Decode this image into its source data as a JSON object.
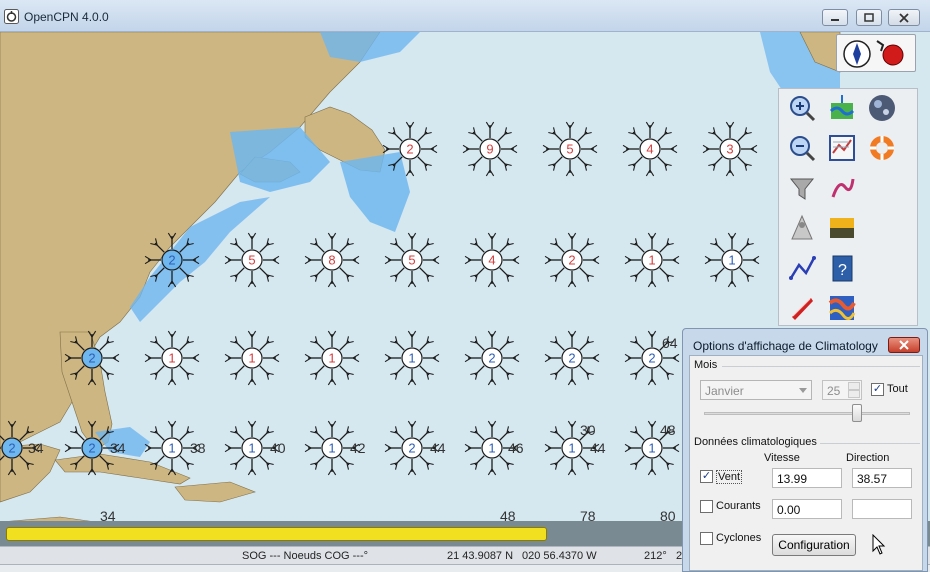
{
  "window": {
    "title": "OpenCPN 4.0.0"
  },
  "map": {
    "markers": [
      {
        "label": "2",
        "color": "#d43f3f"
      },
      {
        "label": "9",
        "color": "#d43f3f"
      },
      {
        "label": "5",
        "color": "#d43f3f"
      },
      {
        "label": "4",
        "color": "#d43f3f"
      },
      {
        "label": "3",
        "color": "#d43f3f"
      },
      {
        "label": "2",
        "color": "#2f5fb7"
      },
      {
        "label": "5",
        "color": "#d43f3f"
      },
      {
        "label": "8",
        "color": "#d43f3f"
      },
      {
        "label": "5",
        "color": "#d43f3f"
      },
      {
        "label": "4",
        "color": "#d43f3f"
      },
      {
        "label": "2",
        "color": "#d43f3f"
      },
      {
        "label": "1",
        "color": "#d43f3f"
      },
      {
        "label": "1",
        "color": "#2f5fb7"
      },
      {
        "label": "2",
        "color": "#2f5fb7"
      },
      {
        "label": "1",
        "color": "#d43f3f"
      },
      {
        "label": "1",
        "color": "#d43f3f"
      },
      {
        "label": "1",
        "color": "#d43f3f"
      },
      {
        "label": "1",
        "color": "#2f5fb7"
      },
      {
        "label": "2",
        "color": "#2f5fb7"
      },
      {
        "label": "2",
        "color": "#2f5fb7"
      },
      {
        "label": "2",
        "color": "#2f5fb7"
      },
      {
        "label": "2",
        "color": "#2f5fb7"
      },
      {
        "label": "2",
        "color": "#2f5fb7"
      },
      {
        "label": "1",
        "color": "#2f5fb7"
      },
      {
        "label": "1",
        "color": "#2f5fb7"
      },
      {
        "label": "1",
        "color": "#2f5fb7"
      },
      {
        "label": "2",
        "color": "#2f5fb7"
      },
      {
        "label": "1",
        "color": "#2f5fb7"
      },
      {
        "label": "1",
        "color": "#2f5fb7"
      },
      {
        "label": "1",
        "color": "#2f5fb7"
      }
    ],
    "side_numbers": [
      "34",
      "34",
      "38",
      "40",
      "42",
      "44",
      "46",
      "44",
      "30",
      "48",
      "64",
      "34",
      "48",
      "78",
      "80"
    ]
  },
  "status": {
    "sog_cog": "SOG --- Noeuds COG ---°",
    "lat": "21 43.9087 N",
    "lon": "020 56.4370 W",
    "bearing": "212°",
    "distance": "2"
  },
  "dialog": {
    "title": "Options d'affichage de Climatology",
    "month_group": "Mois",
    "month_value": "Janvier",
    "day_value": "25",
    "all_label": "Tout",
    "all_checked": true,
    "data_group": "Données climatologiques",
    "speed_header": "Vitesse",
    "direction_header": "Direction",
    "wind_label": "Vent",
    "wind_checked": true,
    "wind_speed": "13.99",
    "wind_direction": "38.57",
    "currents_label": "Courants",
    "currents_checked": false,
    "currents_speed": "0.00",
    "currents_direction": "",
    "cyclones_label": "Cyclones",
    "cyclones_checked": false,
    "config_button": "Configuration"
  },
  "colors": {
    "land": "#cdb681",
    "shallow": "#6fb7ef",
    "sea": "#d5e7ef",
    "progress": "#f1e01f"
  }
}
